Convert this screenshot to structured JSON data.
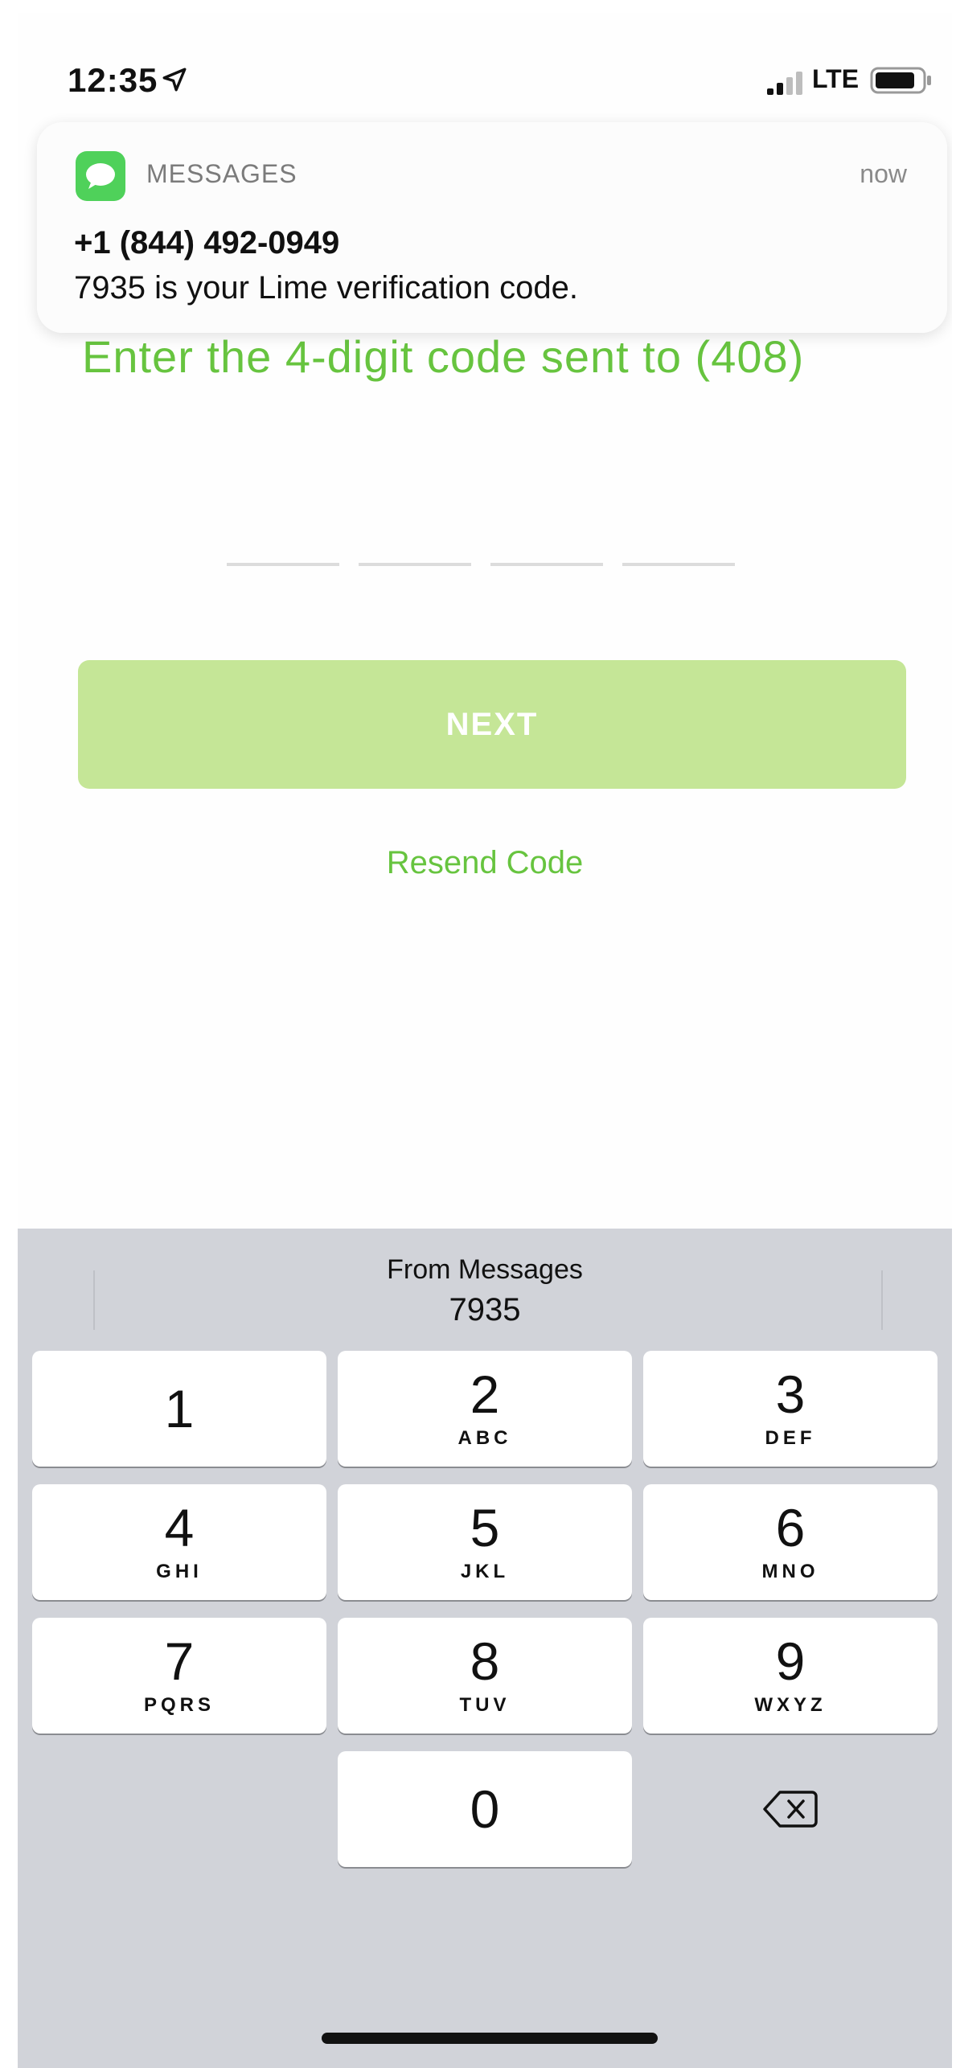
{
  "status_bar": {
    "time": "12:35",
    "network": "LTE",
    "location_icon": "location-arrow-icon",
    "battery_icon": "battery-icon",
    "signal_icon": "cell-signal-icon"
  },
  "notification": {
    "app_name": "MESSAGES",
    "time": "now",
    "sender": "+1 (844) 492-0949",
    "body": "7935 is your Lime verification code.",
    "app_icon": "messages-app-icon"
  },
  "screen": {
    "instruction": "Enter the 4-digit code sent to (408)",
    "code_slots": [
      "",
      "",
      "",
      ""
    ],
    "next_label": "NEXT",
    "resend_label": "Resend Code",
    "accent_color": "#67c43f",
    "button_color": "#c5e697"
  },
  "keyboard": {
    "suggestion_title": "From Messages",
    "suggestion_value": "7935",
    "keys": [
      {
        "digit": "1",
        "letters": ""
      },
      {
        "digit": "2",
        "letters": "ABC"
      },
      {
        "digit": "3",
        "letters": "DEF"
      },
      {
        "digit": "4",
        "letters": "GHI"
      },
      {
        "digit": "5",
        "letters": "JKL"
      },
      {
        "digit": "6",
        "letters": "MNO"
      },
      {
        "digit": "7",
        "letters": "PQRS"
      },
      {
        "digit": "8",
        "letters": "TUV"
      },
      {
        "digit": "9",
        "letters": "WXYZ"
      },
      {
        "digit": "0",
        "letters": ""
      }
    ],
    "backspace_icon": "backspace-icon"
  }
}
